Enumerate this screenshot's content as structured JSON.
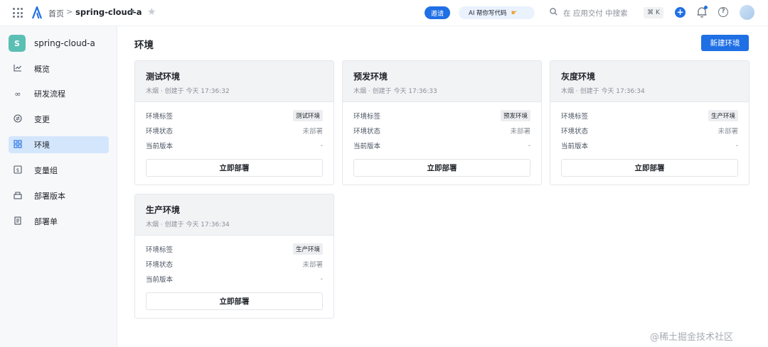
{
  "topbar": {
    "home": "首页",
    "separator": ">",
    "project": "spring-cloud-a",
    "invite": "邀请",
    "ai_button": "AI 帮你写代码",
    "search_placeholder": "在 应用交付 中搜索",
    "shortcut": "⌘ K"
  },
  "sidebar": {
    "badge": "S",
    "project": "spring-cloud-a",
    "items": [
      {
        "label": "概览",
        "icon": "chart-line-icon"
      },
      {
        "label": "研发流程",
        "icon": "infinity-icon"
      },
      {
        "label": "变更",
        "icon": "change-icon"
      },
      {
        "label": "环境",
        "icon": "grid-icon",
        "active": true
      },
      {
        "label": "变量组",
        "icon": "variable-icon"
      },
      {
        "label": "部署版本",
        "icon": "package-icon"
      },
      {
        "label": "部署单",
        "icon": "document-icon"
      }
    ]
  },
  "main": {
    "title": "环境",
    "new_button": "新建环境",
    "row_labels": {
      "tag": "环境标签",
      "status": "环境状态",
      "version": "当前版本"
    },
    "deploy_label": "立即部署",
    "cards": [
      {
        "title": "测试环境",
        "meta": "木烟 · 创建于 今天 17:36:32",
        "tag": "测试环境",
        "status": "未部署",
        "version": "-"
      },
      {
        "title": "预发环境",
        "meta": "木烟 · 创建于 今天 17:36:33",
        "tag": "预发环境",
        "status": "未部署",
        "version": "-"
      },
      {
        "title": "灰度环境",
        "meta": "木烟 · 创建于 今天 17:36:34",
        "tag": "生产环境",
        "status": "未部署",
        "version": "-"
      },
      {
        "title": "生产环境",
        "meta": "木烟 · 创建于 今天 17:36:34",
        "tag": "生产环境",
        "status": "未部署",
        "version": "-"
      }
    ]
  },
  "watermark": "@稀土掘金技术社区"
}
